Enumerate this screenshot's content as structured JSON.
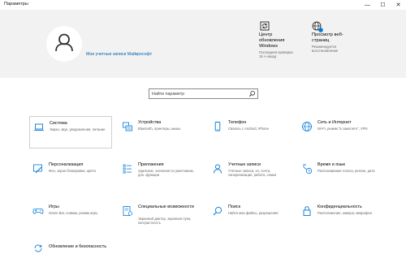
{
  "window": {
    "title": "Параметры",
    "controls": [
      "—",
      "☐",
      "✕"
    ]
  },
  "account": {
    "link": "Мои учетные записи Майкрософт"
  },
  "promos": [
    {
      "id": "update",
      "title": "Центр обновления Windows",
      "subtitle": "Последняя проверка 15 ч назад",
      "icon": "refresh-icon"
    },
    {
      "id": "web",
      "title": "Просмотр веб-страниц",
      "subtitle": "Рекомендуется восстановление",
      "icon": "globe-icon"
    }
  ],
  "search": {
    "placeholder": "Найти параметр"
  },
  "colors": {
    "accent": "#0078d7",
    "link": "#0063b1",
    "header_bg": "#f2f2f2"
  },
  "tiles": [
    {
      "name": "Система",
      "desc": "Экран, звук, уведомления, питание",
      "icon": "laptop-icon"
    },
    {
      "name": "Устройства",
      "desc": "Bluetooth, принтеры, мышь",
      "icon": "keyboard-icon"
    },
    {
      "name": "Телефон",
      "desc": "Связать с Android, iPhone",
      "icon": "phone-icon"
    },
    {
      "name": "Сеть и Интернет",
      "desc": "Wi-Fi, режим \"в самолете\", VPN",
      "icon": "globe-icon"
    },
    {
      "name": "Персонализация",
      "desc": "Фон, экран блокировки, цвета",
      "icon": "brush-icon"
    },
    {
      "name": "Приложения",
      "desc": "Удаление, значения по умолчанию, доп. функции",
      "icon": "apps-list-icon"
    },
    {
      "name": "Учетные записи",
      "desc": "Учетные записи, эл. почта, синхронизация, работа, семья",
      "icon": "person-icon"
    },
    {
      "name": "Время и язык",
      "desc": "Распознавание голоса, регион, дата",
      "icon": "time-language-icon"
    },
    {
      "name": "Игры",
      "desc": "Game Bar, снимки, режим игры",
      "icon": "gamepad-icon"
    },
    {
      "name": "Специальные возможности",
      "desc": "Экранный диктор, экранная лупа, контрастность",
      "icon": "accessibility-icon"
    },
    {
      "name": "Поиск",
      "desc": "Найти мои файлы, разрешения",
      "icon": "search-icon"
    },
    {
      "name": "Конфиденциальность",
      "desc": "Расположение, камера, микрофон",
      "icon": "lock-icon"
    },
    {
      "name": "Обновление и безопасность",
      "desc": "",
      "icon": "sync-icon"
    }
  ]
}
